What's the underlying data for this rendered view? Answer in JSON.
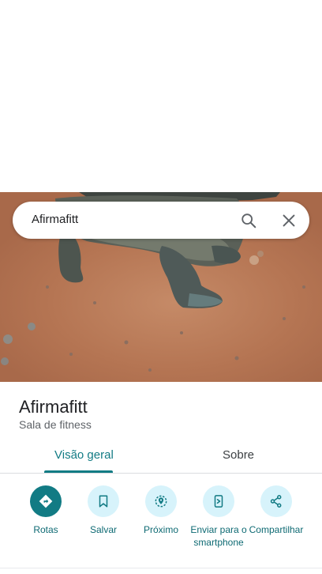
{
  "search": {
    "query": "Afirmafitt"
  },
  "place": {
    "name": "Afirmafitt",
    "category": "Sala de fitness"
  },
  "tabs": [
    {
      "label": "Visão geral",
      "selected": true
    },
    {
      "label": "Sobre",
      "selected": false
    }
  ],
  "actions": [
    {
      "label": "Rotas",
      "icon": "directions-icon"
    },
    {
      "label": "Salvar",
      "icon": "bookmark-icon"
    },
    {
      "label": "Próximo",
      "icon": "nearby-icon"
    },
    {
      "label": "Enviar para o smartphone",
      "icon": "send-to-phone-icon"
    },
    {
      "label": "Compartilhar",
      "icon": "share-icon"
    }
  ],
  "colors": {
    "accent": "#127b84",
    "action_circle": "#d7f3fb",
    "photo_ground": "#b57553"
  }
}
